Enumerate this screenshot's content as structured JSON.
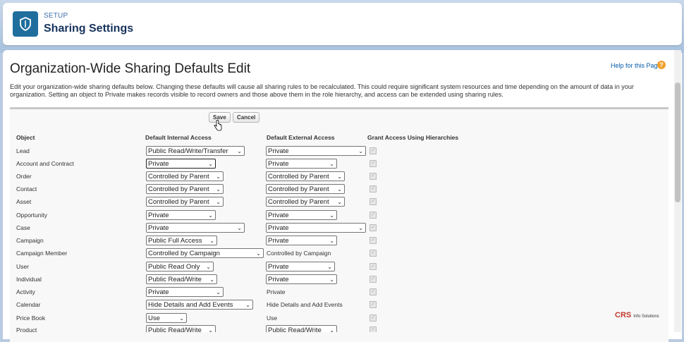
{
  "header": {
    "setup_label": "SETUP",
    "title": "Sharing Settings"
  },
  "page": {
    "title": "Organization-Wide Sharing Defaults Edit",
    "help_link": "Help for this Page",
    "description": "Edit your organization-wide sharing defaults below. Changing these defaults will cause all sharing rules to be recalculated. This could require significant system resources and time depending on the amount of data in your organization. Setting an object to Private makes records visible to record owners and those above them in the role hierarchy, and access can be extended using sharing rules."
  },
  "buttons": {
    "save": "Save",
    "cancel": "Cancel"
  },
  "columns": {
    "object": "Object",
    "internal": "Default Internal Access",
    "external": "Default External Access",
    "hierarchy": "Grant Access Using Hierarchies"
  },
  "rows": [
    {
      "object": "Lead",
      "internal": "Public Read/Write/Transfer",
      "external": "Private"
    },
    {
      "object": "Account and Contract",
      "internal": "Private",
      "external": "Private"
    },
    {
      "object": "Order",
      "internal": "Controlled by Parent",
      "external": "Controlled by Parent"
    },
    {
      "object": "Contact",
      "internal": "Controlled by Parent",
      "external": "Controlled by Parent"
    },
    {
      "object": "Asset",
      "internal": "Controlled by Parent",
      "external": "Controlled by Parent"
    },
    {
      "object": "Opportunity",
      "internal": "Private",
      "external": "Private"
    },
    {
      "object": "Case",
      "internal": "Private",
      "external": "Private"
    },
    {
      "object": "Campaign",
      "internal": "Public Full Access",
      "external": "Private"
    },
    {
      "object": "Campaign Member",
      "internal": "Controlled by Campaign",
      "external": "Controlled by Campaign"
    },
    {
      "object": "User",
      "internal": "Public Read Only",
      "external": "Private"
    },
    {
      "object": "Individual",
      "internal": "Public Read/Write",
      "external": "Private"
    },
    {
      "object": "Activity",
      "internal": "Private",
      "external": "Private"
    },
    {
      "object": "Calendar",
      "internal": "Hide Details and Add Events",
      "external": "Hide Details and Add Events"
    },
    {
      "object": "Price Book",
      "internal": "Use",
      "external": "Use"
    },
    {
      "object": "Product",
      "internal": "Public Read/Write",
      "external": "Public Read/Write"
    }
  ],
  "watermark": {
    "brand": "CRS",
    "suffix": "Info Solutions"
  },
  "icons": {
    "header": "shield-icon",
    "help": "question-icon",
    "cursor": "hand-cursor-icon"
  },
  "colors": {
    "accent": "#1f6e9e",
    "title": "#16325c",
    "help": "#f0a02b"
  }
}
